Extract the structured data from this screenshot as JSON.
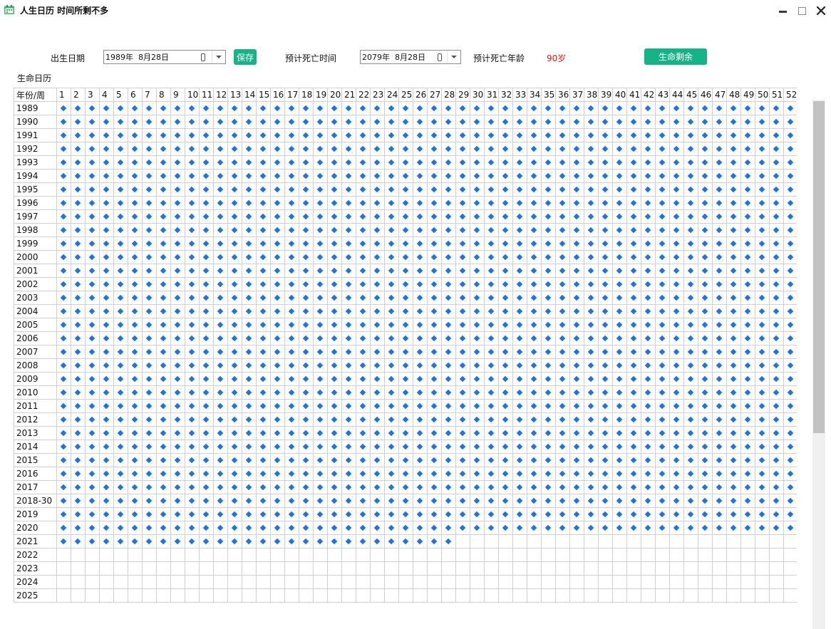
{
  "window": {
    "title": "人生日历 时间所剩不多"
  },
  "toolbar": {
    "birth_label": "出生日期",
    "birth_value": "1989年  8月28日",
    "save_label": "保存",
    "death_time_label": "预计死亡时间",
    "death_value": "2079年  8月28日",
    "death_age_label": "预计死亡年龄",
    "death_age_value": "90岁",
    "remaining_label": "生命剩余"
  },
  "calendar": {
    "section_label": "生命日历",
    "corner_header": "年份/周",
    "week_count": 52,
    "rows": [
      {
        "year": "1989",
        "filled_weeks": 52
      },
      {
        "year": "1990",
        "filled_weeks": 52
      },
      {
        "year": "1991",
        "filled_weeks": 52
      },
      {
        "year": "1992",
        "filled_weeks": 52
      },
      {
        "year": "1993",
        "filled_weeks": 52
      },
      {
        "year": "1994",
        "filled_weeks": 52
      },
      {
        "year": "1995",
        "filled_weeks": 52
      },
      {
        "year": "1996",
        "filled_weeks": 52
      },
      {
        "year": "1997",
        "filled_weeks": 52
      },
      {
        "year": "1998",
        "filled_weeks": 52
      },
      {
        "year": "1999",
        "filled_weeks": 52
      },
      {
        "year": "2000",
        "filled_weeks": 52
      },
      {
        "year": "2001",
        "filled_weeks": 52
      },
      {
        "year": "2002",
        "filled_weeks": 52
      },
      {
        "year": "2003",
        "filled_weeks": 52
      },
      {
        "year": "2004",
        "filled_weeks": 52
      },
      {
        "year": "2005",
        "filled_weeks": 52
      },
      {
        "year": "2006",
        "filled_weeks": 52
      },
      {
        "year": "2007",
        "filled_weeks": 52
      },
      {
        "year": "2008",
        "filled_weeks": 52
      },
      {
        "year": "2009",
        "filled_weeks": 52
      },
      {
        "year": "2010",
        "filled_weeks": 52
      },
      {
        "year": "2011",
        "filled_weeks": 52
      },
      {
        "year": "2012",
        "filled_weeks": 52
      },
      {
        "year": "2013",
        "filled_weeks": 52
      },
      {
        "year": "2014",
        "filled_weeks": 52
      },
      {
        "year": "2015",
        "filled_weeks": 52
      },
      {
        "year": "2016",
        "filled_weeks": 52
      },
      {
        "year": "2017",
        "filled_weeks": 52
      },
      {
        "year": "2018-30",
        "filled_weeks": 52
      },
      {
        "year": "2019",
        "filled_weeks": 52
      },
      {
        "year": "2020",
        "filled_weeks": 52
      },
      {
        "year": "2021",
        "filled_weeks": 28
      },
      {
        "year": "2022",
        "filled_weeks": 0
      },
      {
        "year": "2023",
        "filled_weeks": 0
      },
      {
        "year": "2024",
        "filled_weeks": 0
      },
      {
        "year": "2025",
        "filled_weeks": 0
      }
    ]
  },
  "colors": {
    "accent_green": "#14b488",
    "week_marker_blue": "#1a73e8",
    "age_red": "#d42020"
  },
  "icons": {
    "app": "calendar-icon",
    "week_marker": "diamond-icon"
  }
}
